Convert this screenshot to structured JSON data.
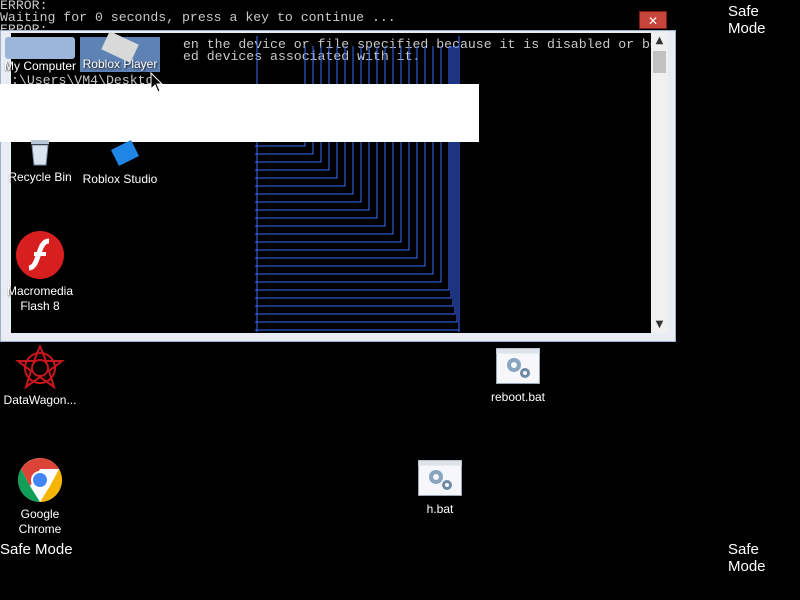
{
  "console": {
    "line1": "ERROR:",
    "line2": "Waiting for 0 seconds, press a key to continue ...",
    "line3": "ERROR:",
    "error_message_1": "en the device or file specified because it is disabled or be",
    "error_message_2": "ed devices associated with it.",
    "prompt": ":\\Users\\VM4\\Deskto"
  },
  "watermarks": {
    "top_right": "Safe Mode",
    "bottom_left": "Safe Mode",
    "bottom_right": "Safe Mode"
  },
  "window": {
    "close_glyph": "✕",
    "scroll_up_glyph": "▲",
    "scroll_down_glyph": "▼"
  },
  "desktop_icons": {
    "my_computer": "My Computer",
    "roblox_player": "Roblox Player",
    "recycle_bin": "Recycle Bin",
    "roblox_studio": "Roblox Studio",
    "macromedia_flash": "Macromedia Flash 8",
    "datawagon": "DataWagon...",
    "reboot_bat": "reboot.bat",
    "google_chrome": "Google Chrome",
    "h_bat": "h.bat"
  },
  "colors": {
    "background": "#000000",
    "window_frame": "#e9edf3",
    "console_text": "#c8c8c8",
    "close_button": "#c8453b",
    "glitch_lines": "#3a68ff"
  }
}
